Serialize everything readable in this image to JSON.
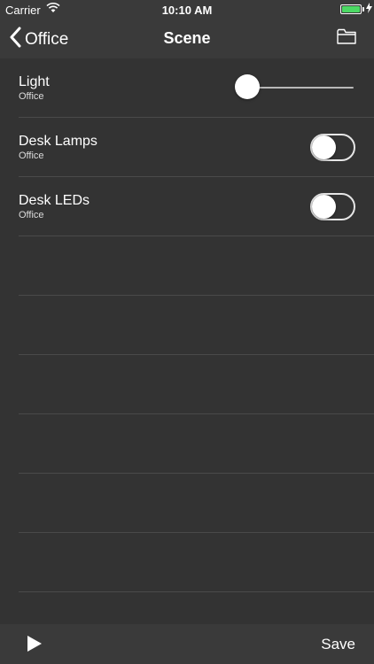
{
  "status_bar": {
    "carrier": "Carrier",
    "time": "10:10 AM",
    "battery_color": "#4cd964"
  },
  "nav": {
    "back_label": "Office",
    "title": "Scene",
    "back_icon": "chevron-left-icon",
    "right_icon": "folder-icon"
  },
  "rows": [
    {
      "name": "Light",
      "room": "Office",
      "control": "slider",
      "level": 0.0
    },
    {
      "name": "Desk Lamps",
      "room": "Office",
      "control": "toggle",
      "on": false
    },
    {
      "name": "Desk LEDs",
      "room": "Office",
      "control": "toggle",
      "on": false
    }
  ],
  "toolbar": {
    "play_icon": "play-icon",
    "save_label": "Save"
  }
}
